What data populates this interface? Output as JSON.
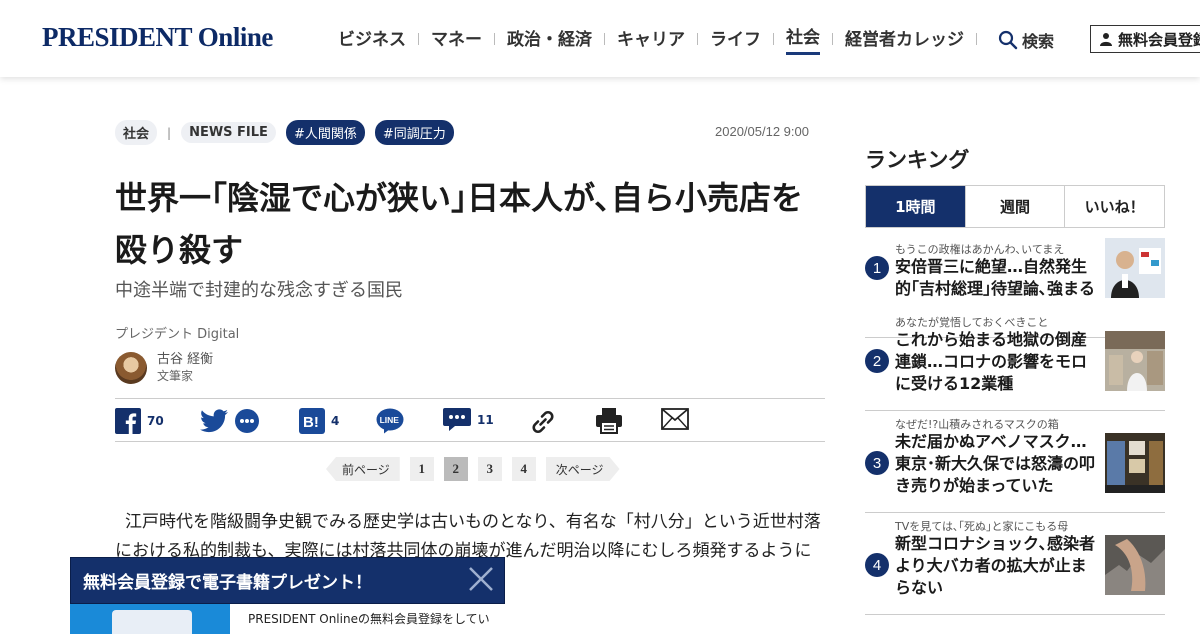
{
  "header": {
    "logo": "PRESIDENT Online",
    "nav": [
      "ビジネス",
      "マネー",
      "政治・経済",
      "キャリア",
      "ライフ",
      "社会",
      "経営者カレッジ"
    ],
    "active_nav": "社会",
    "search_label": "検索",
    "member_label": "無料会員登録"
  },
  "article": {
    "category": "社会",
    "series": "NEWS FILE",
    "hashtags": [
      "#人間関係",
      "#同調圧力"
    ],
    "date": "2020/05/12 9:00",
    "title": "世界一｢陰湿で心が狭い｣日本人が､自ら小売店を殴り殺す",
    "subtitle": "中途半端で封建的な残念すぎる国民",
    "publisher": "プレジデント Digital",
    "author_name": "古谷 経衡",
    "author_role": "文筆家",
    "body": "江戸時代を階級闘争史観でみる歴史学は古いものとなり、有名な「村八分」という近世村落における私的制裁も、実際には村落共同体の崩壊が進んだ明治以降にむしろ頻発するようになったという見方が主流になってきた。"
  },
  "share": {
    "facebook_count": "70",
    "hatena_count": "4",
    "line_label": "LINE",
    "comment_count": "11"
  },
  "pager": {
    "prev": "前ページ",
    "pages": [
      "1",
      "2",
      "3",
      "4"
    ],
    "current": "2",
    "next": "次ページ"
  },
  "popup": {
    "title": "無料会員登録で電子書籍プレゼント！",
    "text": "PRESIDENT Onlineの無料会員登録をしてい"
  },
  "ranking": {
    "title": "ランキング",
    "tabs": [
      "1時間",
      "週間",
      "いいね！"
    ],
    "active_tab": "1時間",
    "items": [
      {
        "rank": "1",
        "kicker": "もうこの政権はあかんわ､いてまえ",
        "headline": "安倍晋三に絶望…自然発生的｢吉村総理｣待望論､強まる"
      },
      {
        "rank": "2",
        "kicker": "あなたが覚悟しておくべきこと",
        "headline": "これから始まる地獄の倒産連鎖…コロナの影響をモロに受ける12業種"
      },
      {
        "rank": "3",
        "kicker": "なぜだ!?山積みされるマスクの箱",
        "headline": "未だ届かぬアベノマスク…東京･新大久保では怒濤の叩き売りが始まっていた"
      },
      {
        "rank": "4",
        "kicker": "TVを見ては､｢死ぬ｣と家にこもる母",
        "headline": "新型コロナショック､感染者より大バカ者の拡大が止まらない"
      }
    ]
  }
}
